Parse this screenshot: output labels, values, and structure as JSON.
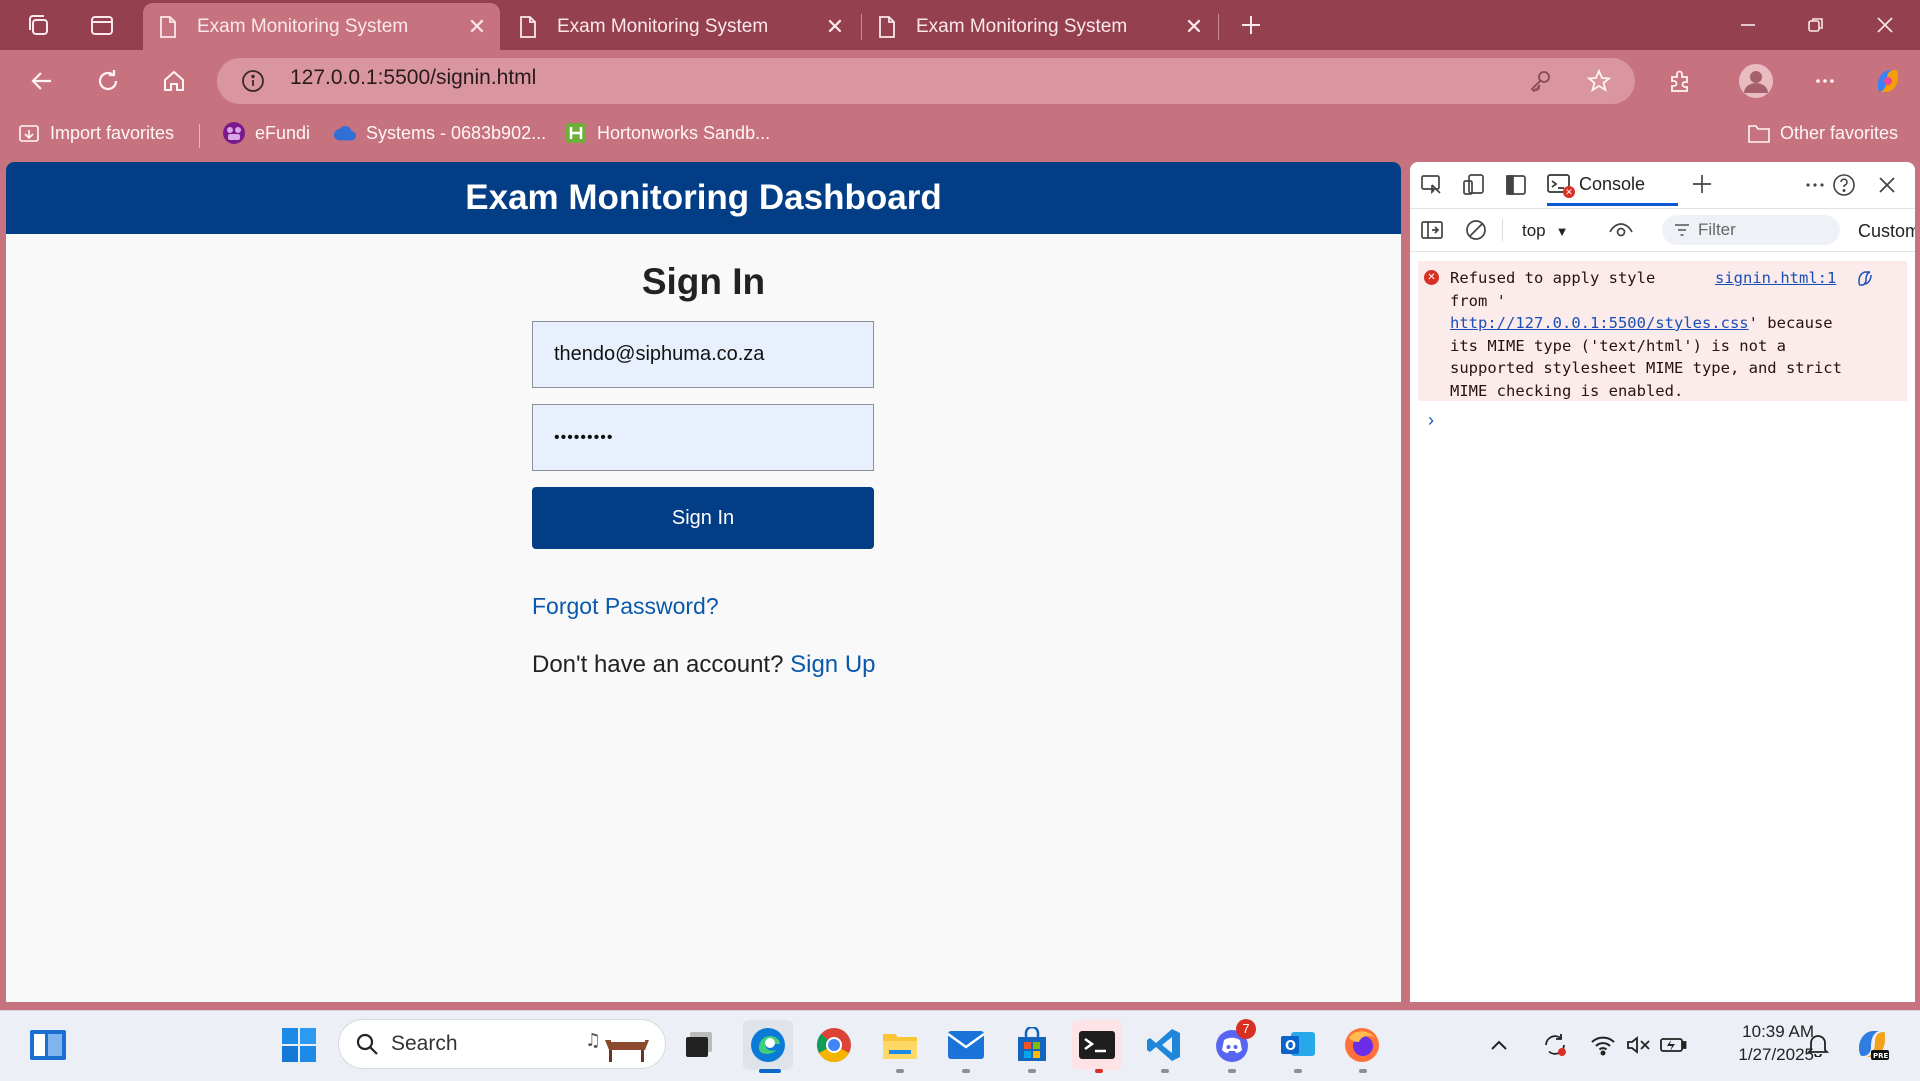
{
  "browser": {
    "tabs": [
      {
        "title": "Exam Monitoring System",
        "active": true
      },
      {
        "title": "Exam Monitoring System",
        "active": false
      },
      {
        "title": "Exam Monitoring System",
        "active": false
      }
    ],
    "url": "127.0.0.1:5500/signin.html",
    "favorites": [
      {
        "label": "Import favorites",
        "icon": "import-icon"
      },
      {
        "label": "eFundi",
        "icon": "efundi-icon"
      },
      {
        "label": "Systems - 0683b902...",
        "icon": "cloud-icon"
      },
      {
        "label": "Hortonworks Sandb...",
        "icon": "hortonworks-icon"
      }
    ],
    "other_favorites": "Other favorites",
    "colors": {
      "frame": "#94404f",
      "toolbar": "#c7737f"
    }
  },
  "page": {
    "header_title": "Exam Monitoring Dashboard",
    "signin_title": "Sign In",
    "email_value": "thendo@siphuma.co.za",
    "password_value": "•••••••••",
    "signin_button": "Sign In",
    "forgot_link": "Forgot Password?",
    "signup_prompt": "Don't have an account?",
    "signup_link": "Sign Up",
    "colors": {
      "primary": "#033d85",
      "link": "#0a58ac"
    }
  },
  "devtools": {
    "console_tab": "Console",
    "context": "top",
    "filter_placeholder": "Filter",
    "levels": "Custom",
    "error": {
      "line1": "Refused to apply style",
      "line2": "from '",
      "link": "http://127.0.0.1:5500/styles.css",
      "line3_after": "' because",
      "line4": "its MIME type ('text/html') is not a",
      "line5": "supported stylesheet MIME type, and strict",
      "line6": "MIME checking is enabled.",
      "source": "signin.html:1"
    }
  },
  "taskbar": {
    "search_placeholder": "Search",
    "time": "10:39 AM",
    "date": "1/27/2025",
    "discord_badge": "7"
  }
}
